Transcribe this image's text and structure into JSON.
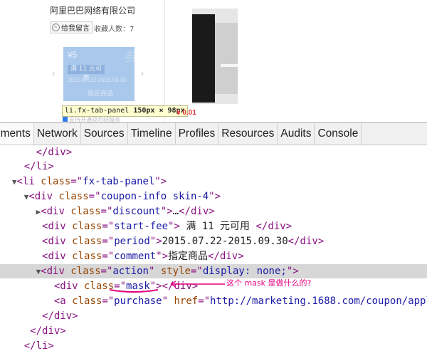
{
  "page": {
    "company": "阿里巴巴网络有限公司",
    "message_button": "给我留言",
    "favorites": "收藏人数：7",
    "carousel_prev": "‹",
    "carousel_next": "›",
    "coupon": {
      "discount": "¥5",
      "start_fee": "满 11 元可用",
      "period": "2015.07.22-2015.09.30",
      "comment": "指定商品",
      "deco": "券"
    },
    "tooltip": {
      "selector": "li.fx-tab-panel",
      "dims": "150px × 98px"
    },
    "below_text": "支持开通双月结服务",
    "price": "¥ 0.01"
  },
  "devtools": {
    "tabs": [
      "ements",
      "Network",
      "Sources",
      "Timeline",
      "Profiles",
      "Resources",
      "Audits",
      "Console"
    ],
    "annotation": "这个 mask 是做什么的?"
  },
  "colors": {
    "coupon_bg": "#a9c8ec",
    "tag": "#881280",
    "attr": "#994500",
    "value": "#1a1aa6",
    "annotation": "#e4007f",
    "highlight_row": "#d7d7d7"
  }
}
